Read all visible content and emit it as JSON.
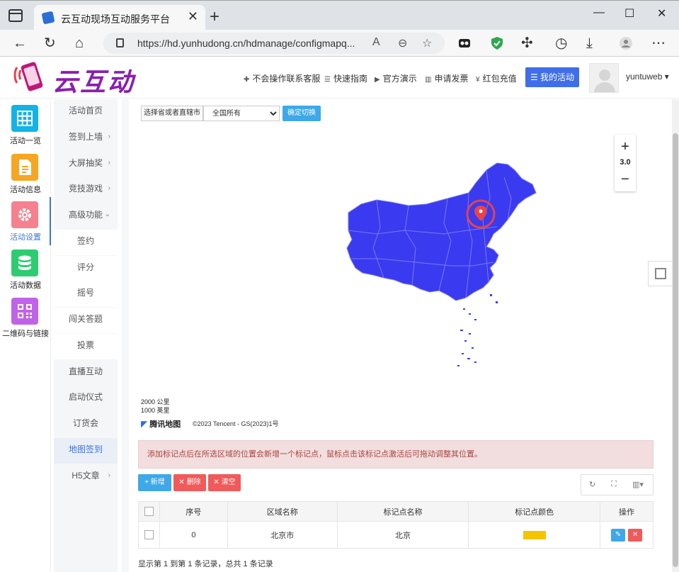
{
  "browser": {
    "tab_title": "云互动现场互动服务平台",
    "url": "https://hd.yunhudong.cn/hdmanage/configmapq...",
    "zoom_label": "A",
    "window_controls": [
      "—",
      "☐",
      "✕"
    ]
  },
  "header": {
    "logo_text": "云互动",
    "links": [
      {
        "label": "不会操作联系客服"
      },
      {
        "label": "快速指南"
      },
      {
        "label": "官方演示"
      },
      {
        "label": "申请发票"
      },
      {
        "label": "红包充值"
      }
    ],
    "my_activity": "我的活动",
    "username": "yuntuweb"
  },
  "left_nav": {
    "items": [
      {
        "label": "活动一览",
        "color": "#12b3e6",
        "icon": "grid-icon"
      },
      {
        "label": "活动信息",
        "color": "#f5a623",
        "icon": "document-icon"
      },
      {
        "label": "活动设置",
        "color": "#f5808e",
        "icon": "gear-icon",
        "active": true
      },
      {
        "label": "活动数据",
        "color": "#2ecc71",
        "icon": "database-icon"
      },
      {
        "label": "二维码与链接",
        "color": "#c063e8",
        "icon": "qrcode-icon"
      }
    ]
  },
  "sub_nav": {
    "items": [
      {
        "label": "活动首页",
        "arrow": ""
      },
      {
        "label": "签到上墙",
        "arrow": "›"
      },
      {
        "label": "大屏抽奖",
        "arrow": "›"
      },
      {
        "label": "竞技游戏",
        "arrow": "›"
      },
      {
        "label": "高级功能",
        "arrow": "⌄"
      },
      {
        "label": "签约",
        "arrow": "",
        "child": true
      },
      {
        "label": "评分",
        "arrow": "",
        "child": true
      },
      {
        "label": "摇号",
        "arrow": "",
        "child": true
      },
      {
        "label": "闯关答题",
        "arrow": "",
        "child": true
      },
      {
        "label": "投票",
        "arrow": "",
        "child": true
      },
      {
        "label": "直播互动",
        "arrow": ""
      },
      {
        "label": "启动仪式",
        "arrow": ""
      },
      {
        "label": "订货会",
        "arrow": ""
      },
      {
        "label": "地图签到",
        "arrow": "",
        "active": true
      },
      {
        "label": "H5文章",
        "arrow": "›"
      }
    ]
  },
  "map": {
    "province_label": "选择省或者直辖市",
    "province_value": "全国所有",
    "confirm_label": "确定切换",
    "zoom_level": "3.0",
    "zoom_in": "+",
    "zoom_out": "−",
    "scale_km": "2000 公里",
    "scale_mi": "1000 英里",
    "provider": "腾讯地图",
    "copyright": "©2023 Tencent - GS(2023)1号",
    "map_color": "#3a3af0",
    "marker_color": "#e8424a"
  },
  "alert_text": "添加标记点后在所选区域的位置会新增一个标记点，鼠标点击该标记点激活后可拖动调整其位置。",
  "toolbar": {
    "add": "+ 新增",
    "delete": "✕ 删除",
    "clear": "✕ 清空",
    "refresh_icon": "↻",
    "fullscreen_icon": "⛶",
    "columns_icon": "▥▾"
  },
  "table": {
    "headers": [
      "序号",
      "区域名称",
      "标记点名称",
      "标记点颜色",
      "操作"
    ],
    "rows": [
      {
        "index": "0",
        "region": "北京市",
        "marker": "北京",
        "color": "#f5c400"
      }
    ]
  },
  "pagination": "显示第 1 到第 1 条记录，总共 1 条记录"
}
